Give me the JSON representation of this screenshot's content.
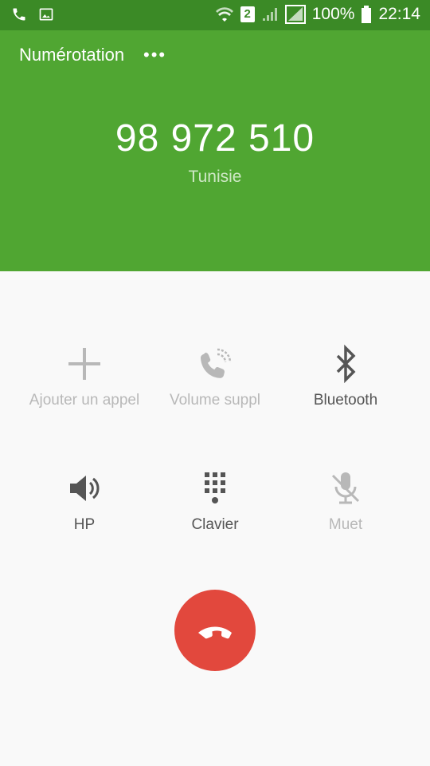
{
  "status_bar": {
    "battery": "100%",
    "time": "22:14",
    "sim": "2"
  },
  "call": {
    "status": "Numérotation",
    "dots": "•••",
    "number": "98 972 510",
    "country": "Tunisie"
  },
  "controls": {
    "add_call": "Ajouter un appel",
    "extra_volume": "Volume suppl",
    "bluetooth": "Bluetooth",
    "speaker": "HP",
    "keypad": "Clavier",
    "mute": "Muet"
  },
  "colors": {
    "header": "#50a632",
    "statusbar": "#3b8a26",
    "end_call": "#e2483d"
  }
}
